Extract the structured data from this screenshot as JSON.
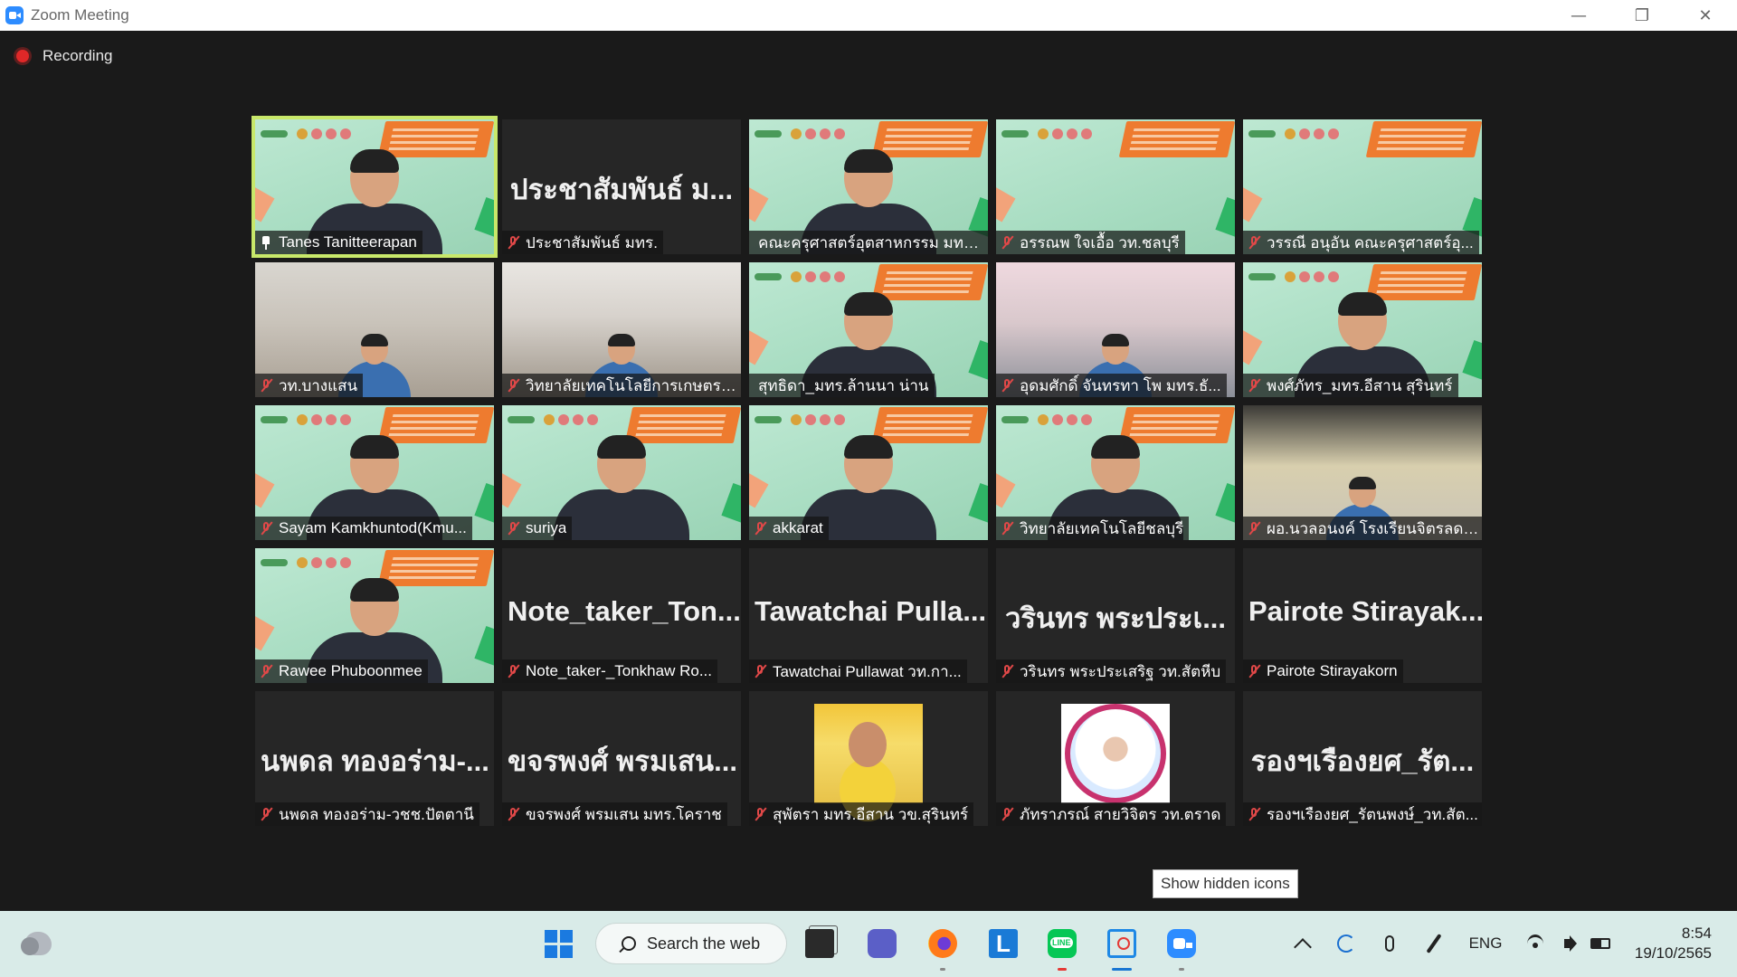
{
  "window": {
    "title": "Zoom Meeting",
    "controls": {
      "minimize": "—",
      "restore": "❐",
      "close": "✕"
    }
  },
  "recording": {
    "label": "Recording",
    "color": "#e02828"
  },
  "participants": [
    {
      "video_label": "Tanes Tanitteerapan",
      "big_name": "",
      "type": "slide",
      "active": true,
      "muted": false,
      "pinned": true
    },
    {
      "video_label": "ประชาสัมพันธ์ มทร.",
      "big_name": "ประชาสัมพันธ์ ม...",
      "type": "name",
      "muted": true
    },
    {
      "video_label": "คณะครุศาสตร์อุตสาหกรรม มทร.ธั...",
      "big_name": "",
      "type": "slide",
      "muted": false
    },
    {
      "video_label": "อรรณพ ใจเอื้อ วท.ชลบุรี",
      "big_name": "",
      "type": "slide-empty",
      "muted": true
    },
    {
      "video_label": "วรรณี อนุอัน คณะครุศาสตร์อุ...",
      "big_name": "",
      "type": "slide-empty",
      "muted": true
    },
    {
      "video_label": "วท.บางแสน",
      "big_name": "",
      "type": "room",
      "muted": true
    },
    {
      "video_label": "วิทยาลัยเทคโนโลยีการเกษตรแ...",
      "big_name": "",
      "type": "room2",
      "muted": true
    },
    {
      "video_label": "สุทธิดา_มทร.ล้านนา น่าน",
      "big_name": "",
      "type": "slide",
      "muted": false
    },
    {
      "video_label": "อุดมศักดิ์ จันทรทา โพ มทร.ธั...",
      "big_name": "",
      "type": "room3",
      "muted": true
    },
    {
      "video_label": "พงศ์ภัทร_มทร.อีสาน สุรินทร์",
      "big_name": "",
      "type": "slide",
      "muted": true
    },
    {
      "video_label": "Sayam Kamkhuntod(Kmu...",
      "big_name": "",
      "type": "slide",
      "muted": true
    },
    {
      "video_label": "suriya",
      "big_name": "",
      "type": "slide",
      "muted": true
    },
    {
      "video_label": "akkarat",
      "big_name": "",
      "type": "slide",
      "muted": true
    },
    {
      "video_label": "วิทยาลัยเทคโนโลยีชลบุรี",
      "big_name": "",
      "type": "slide",
      "muted": true
    },
    {
      "video_label": "ผอ.นวลอนงค์ โรงเรียนจิตรลดา...",
      "big_name": "",
      "type": "room4",
      "muted": true
    },
    {
      "video_label": "Rawee Phuboonmee",
      "big_name": "",
      "type": "slide",
      "muted": true
    },
    {
      "video_label": "Note_taker-_Tonkhaw Ro...",
      "big_name": "Note_taker_Ton...",
      "type": "name",
      "muted": true
    },
    {
      "video_label": "Tawatchai Pullawat วท.กา...",
      "big_name": "Tawatchai Pulla...",
      "type": "name",
      "muted": true
    },
    {
      "video_label": "วรินทร พระประเสริฐ วท.สัตหีบ",
      "big_name": "วรินทร พระประเ...",
      "type": "name",
      "muted": true
    },
    {
      "video_label": "Pairote Stirayakorn",
      "big_name": "Pairote Stirayak...",
      "type": "name",
      "muted": true
    },
    {
      "video_label": "นพดล ทองอร่าม-วชช.ปัตตานี",
      "big_name": "นพดล ทองอร่าม-...",
      "type": "name",
      "muted": true
    },
    {
      "video_label": "ขจรพงศ์ พรมเสน มทร.โคราช",
      "big_name": "ขจรพงศ์ พรมเสน...",
      "type": "name",
      "muted": true
    },
    {
      "video_label": "สุพัตรา มทร.อีสาน วข.สุรินทร์",
      "big_name": "",
      "type": "avatar-photo",
      "muted": true
    },
    {
      "video_label": "ภัทราภรณ์ สายวิจิตร วท.ตราด",
      "big_name": "",
      "type": "avatar-badge",
      "muted": true
    },
    {
      "video_label": "รองฯเรืองยศ_รัตนพงษ์_วท.สัต...",
      "big_name": "รองฯเรืองยศ_รัต...",
      "type": "name",
      "muted": true
    }
  ],
  "tooltip": {
    "text": "Show hidden icons"
  },
  "taskbar": {
    "search_label": "Search the web",
    "apps": [
      "task-view",
      "teams",
      "firefox",
      "l-app",
      "line",
      "snipping-tool",
      "zoom"
    ],
    "l_app_letter": "L",
    "tray": {
      "language": "ENG"
    },
    "clock": {
      "time": "8:54",
      "date": "19/10/2565"
    }
  },
  "colors": {
    "active_speaker_outline": "#c8e86a",
    "muted_icon": "#e04848",
    "taskbar_bg": "#d9ebe8"
  }
}
